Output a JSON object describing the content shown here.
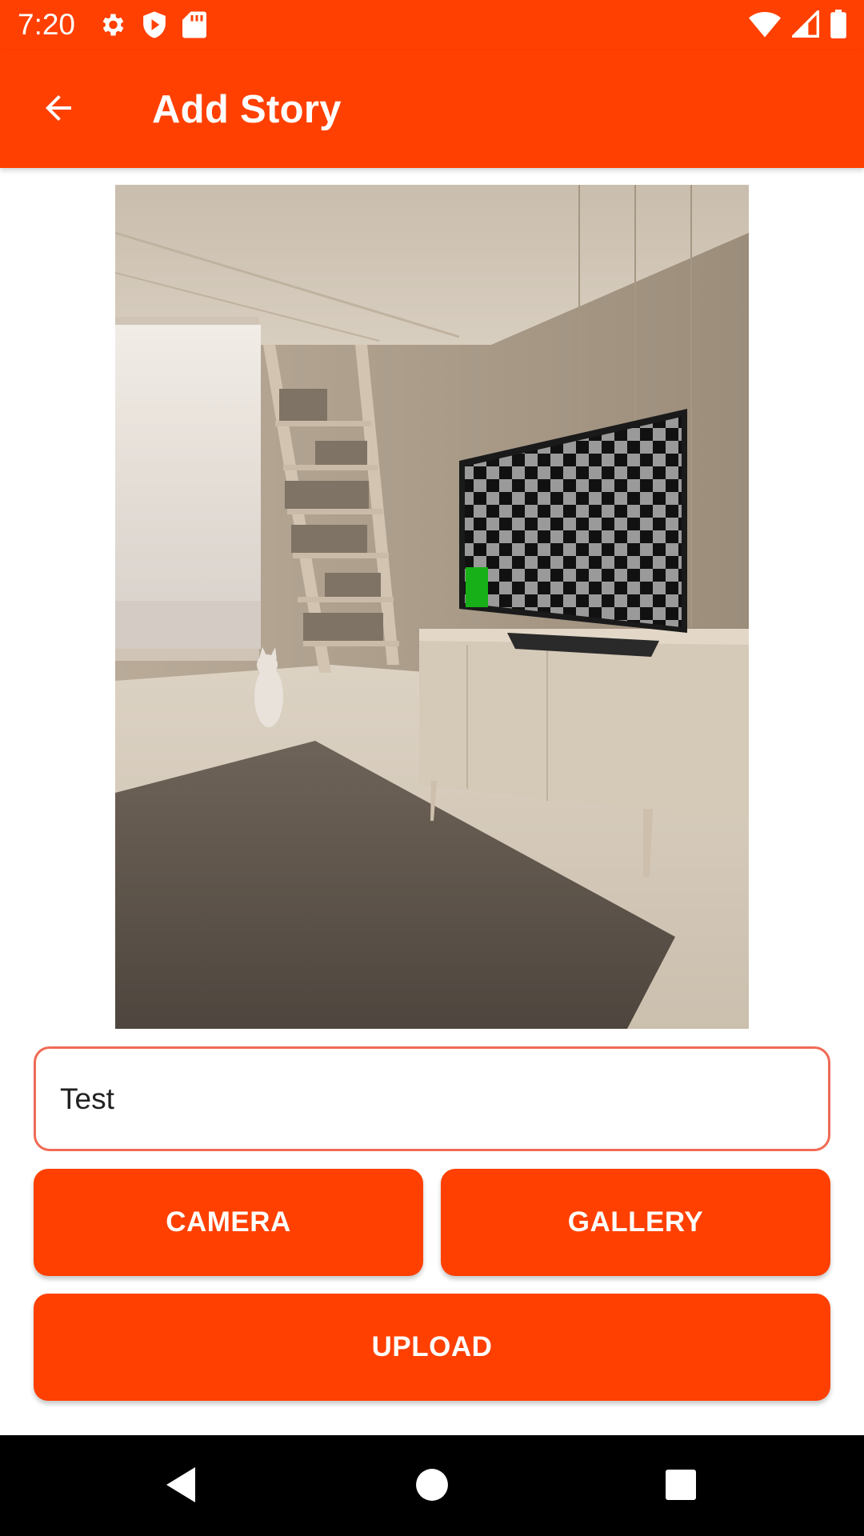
{
  "status_bar": {
    "time": "7:20",
    "left_icons": [
      "settings-icon",
      "play-protect-icon",
      "sd-card-icon"
    ],
    "right_icons": [
      "wifi-icon",
      "cellular-signal-icon",
      "battery-icon"
    ]
  },
  "app_bar": {
    "title": "Add Story",
    "back_icon": "arrow-back-icon",
    "color": "#ff4000"
  },
  "preview": {
    "description_icon": "image-preview"
  },
  "form": {
    "description_value": "Test"
  },
  "buttons": {
    "camera": "CAMERA",
    "gallery": "GALLERY",
    "upload": "UPLOAD"
  },
  "nav_bar": {
    "icons": [
      "back-triangle-icon",
      "home-circle-icon",
      "recents-square-icon"
    ]
  },
  "colors": {
    "accent": "#ff4000",
    "input_border": "#f06a55"
  }
}
